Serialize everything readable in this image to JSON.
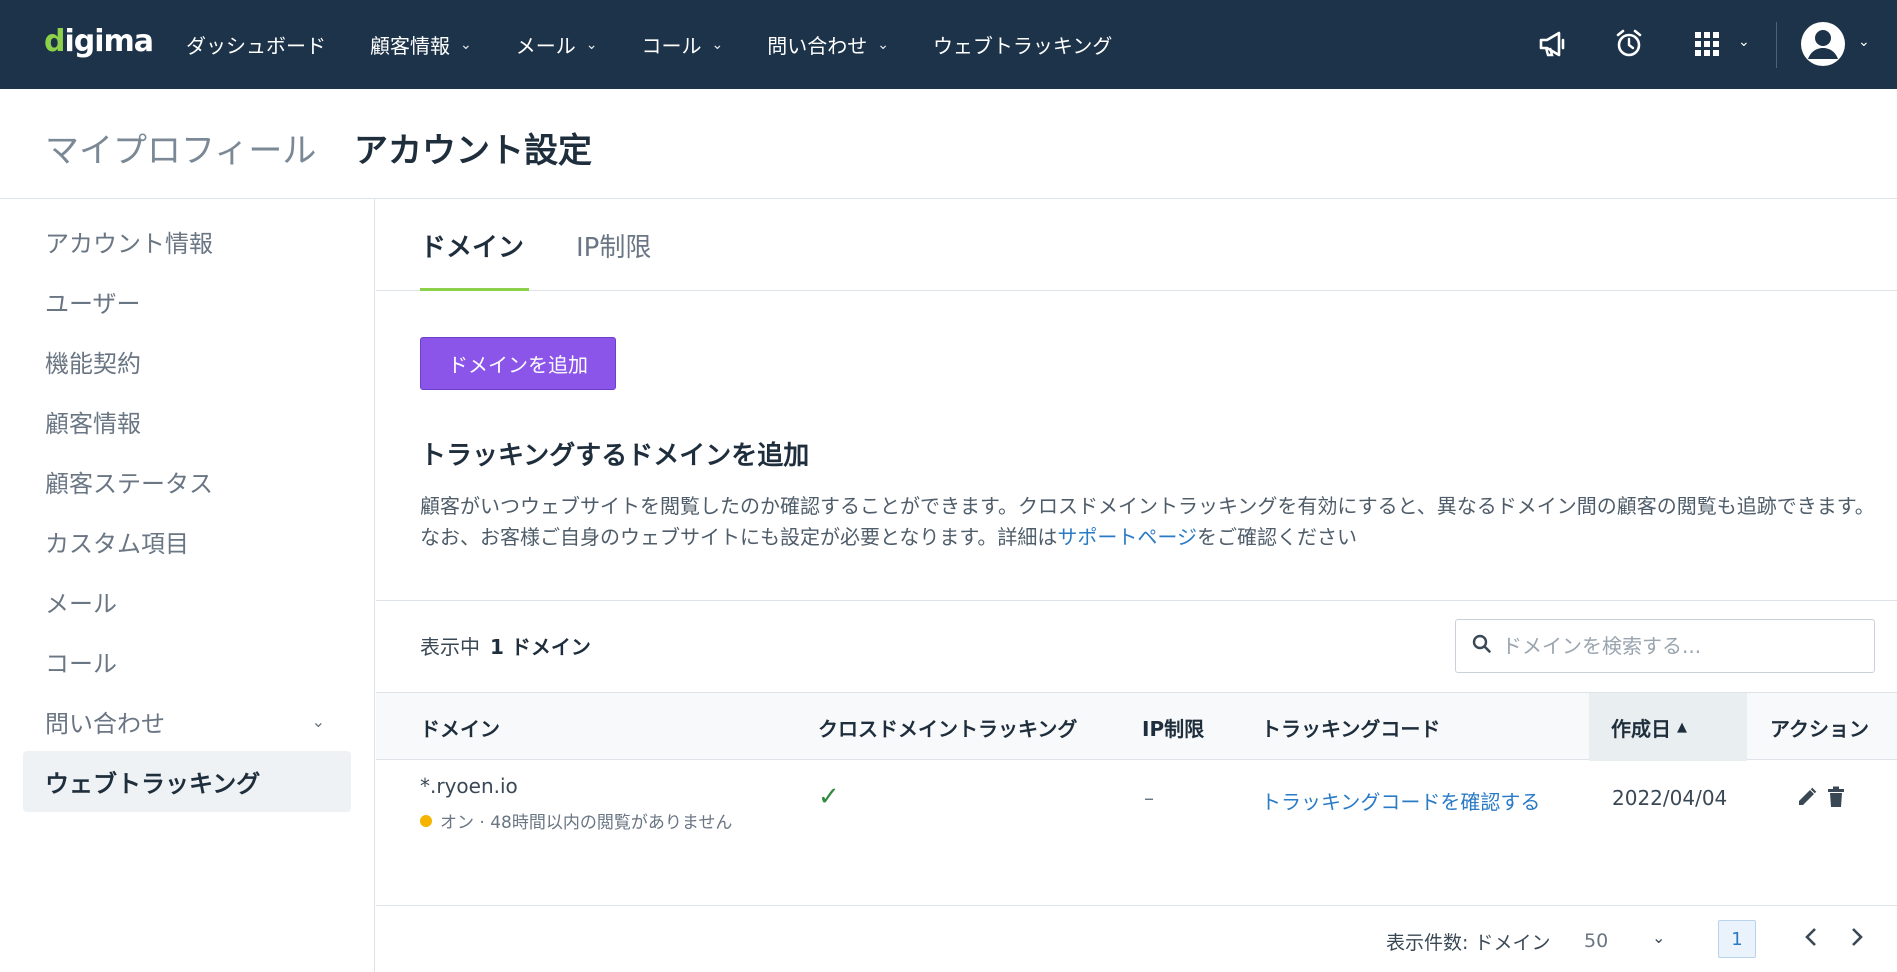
{
  "app": {
    "logo": "digima"
  },
  "nav": {
    "items": [
      {
        "label": "ダッシュボード",
        "dropdown": false
      },
      {
        "label": "顧客情報",
        "dropdown": true
      },
      {
        "label": "メール",
        "dropdown": true
      },
      {
        "label": "コール",
        "dropdown": true
      },
      {
        "label": "問い合わせ",
        "dropdown": true
      },
      {
        "label": "ウェブトラッキング",
        "dropdown": false
      }
    ],
    "icons": [
      "megaphone-icon",
      "alarm-clock-icon",
      "apps-grid-icon",
      "user-avatar-icon"
    ]
  },
  "breadcrumb": {
    "parent": "マイプロフィール",
    "current": "アカウント設定"
  },
  "sidebar": {
    "items": [
      {
        "label": "アカウント情報"
      },
      {
        "label": "ユーザー"
      },
      {
        "label": "機能契約"
      },
      {
        "label": "顧客情報"
      },
      {
        "label": "顧客ステータス"
      },
      {
        "label": "カスタム項目"
      },
      {
        "label": "メール"
      },
      {
        "label": "コール"
      },
      {
        "label": "問い合わせ"
      },
      {
        "label": "ウェブトラッキング"
      }
    ],
    "active_index": 9
  },
  "tabs": [
    {
      "label": "ドメイン"
    },
    {
      "label": "IP制限"
    }
  ],
  "main": {
    "add_button": "ドメインを追加",
    "section_title": "トラッキングするドメインを追加",
    "description_before": "顧客がいつウェブサイトを閲覧したのか確認することができます。クロスドメイントラッキングを有効にすると、異なるドメイン間の顧客の閲覧も追跡できます。なお、お客様ご自身のウェブサイトにも設定が必要となります。詳細は",
    "description_link": "サポートページ",
    "description_after": "をご確認ください"
  },
  "list": {
    "count_label": "表示中",
    "count_value": "1 ドメイン",
    "search_placeholder": "ドメインを検索する..."
  },
  "table": {
    "headers": [
      "ドメイン",
      "クロスドメイントラッキング",
      "IP制限",
      "トラッキングコード",
      "作成日",
      "アクション"
    ],
    "sorted_column": "作成日",
    "sort_indicator": "▲",
    "rows": [
      {
        "domain": "*.ryoen.io",
        "status": "オン · 48時間以内の閲覧がありません",
        "cross_domain": "✓",
        "ip_restriction": "–",
        "tracking_code": "トラッキングコードを確認する",
        "created": "2022/04/04"
      }
    ]
  },
  "pagination": {
    "per_page_label": "表示件数: ドメイン",
    "per_page": "50",
    "current_page": "1"
  },
  "colors": {
    "topbar": "#1d3349",
    "accent_green": "#8dd14b",
    "button_purple": "#8b55e9",
    "link_blue": "#2a7bc6",
    "status_dot": "#f5b400"
  }
}
